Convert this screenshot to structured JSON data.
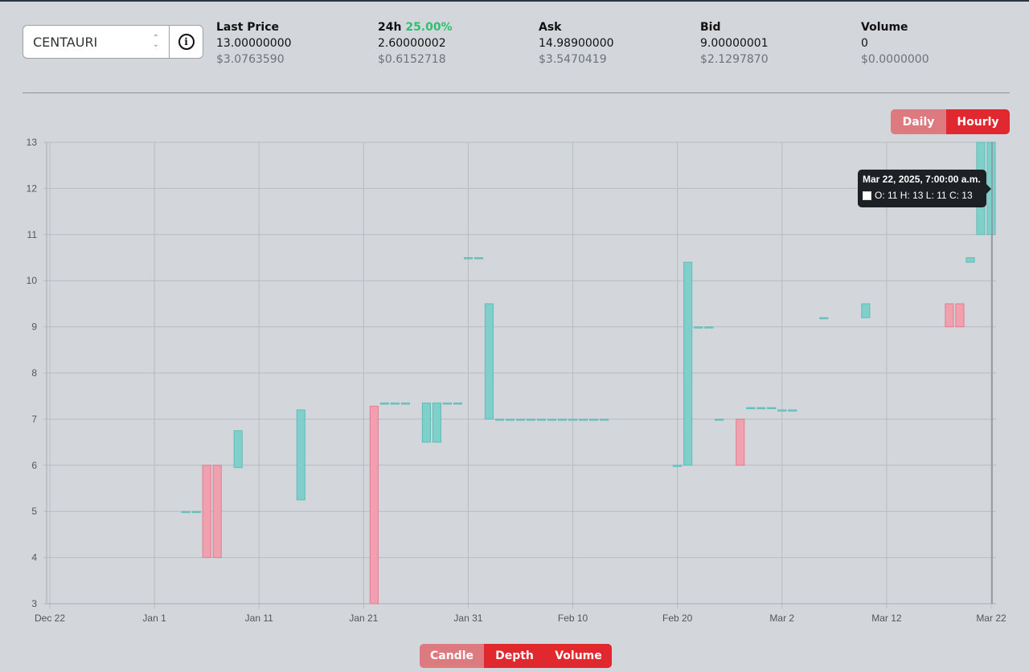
{
  "market": {
    "selected": "CENTAURI"
  },
  "stats": {
    "last_price": {
      "label": "Last Price",
      "value": "13.00000000",
      "usd": "$3.0763590"
    },
    "change_24h": {
      "label": "24h",
      "pct": "25.00%",
      "value": "2.60000002",
      "usd": "$0.6152718"
    },
    "ask": {
      "label": "Ask",
      "value": "14.98900000",
      "usd": "$3.5470419"
    },
    "bid": {
      "label": "Bid",
      "value": "9.00000001",
      "usd": "$2.1297870"
    },
    "volume": {
      "label": "Volume",
      "value": "0",
      "usd": "$0.0000000"
    }
  },
  "interval_buttons": {
    "daily": "Daily",
    "hourly": "Hourly",
    "active": "Hourly"
  },
  "view_buttons": {
    "candle": "Candle",
    "depth": "Depth",
    "volume": "Volume",
    "active": "Candle"
  },
  "tooltip": {
    "title": "Mar 22, 2025, 7:00:00 a.m.",
    "ohlc": "O: 11  H: 13  L: 11  C: 13"
  },
  "colors": {
    "up": "#7fcfcb",
    "down": "#f0a0ae",
    "accent": "#e0282e"
  },
  "chart_data": {
    "type": "candlestick",
    "x_axis": "date",
    "xlim": [
      "2024-12-22",
      "2025-03-22"
    ],
    "x_tick_labels": [
      "Dec 22",
      "Jan 1",
      "Jan 11",
      "Jan 21",
      "Jan 31",
      "Feb 10",
      "Feb 20",
      "Mar 2",
      "Mar 12",
      "Mar 22"
    ],
    "ylim": [
      3,
      13
    ],
    "y_ticks": [
      3,
      4,
      5,
      6,
      7,
      8,
      9,
      10,
      11,
      12,
      13
    ],
    "grid": true,
    "candles": [
      {
        "date": "2025-01-04",
        "o": 5,
        "h": 5,
        "l": 5,
        "c": 5
      },
      {
        "date": "2025-01-05",
        "o": 5,
        "h": 5,
        "l": 5,
        "c": 5
      },
      {
        "date": "2025-01-06",
        "o": 6,
        "h": 6,
        "l": 4,
        "c": 4
      },
      {
        "date": "2025-01-07",
        "o": 6,
        "h": 6,
        "l": 4,
        "c": 4
      },
      {
        "date": "2025-01-09",
        "o": 5.95,
        "h": 6.75,
        "l": 5.95,
        "c": 6.75
      },
      {
        "date": "2025-01-15",
        "o": 5.25,
        "h": 7.2,
        "l": 5.25,
        "c": 7.2
      },
      {
        "date": "2025-01-22",
        "o": 7.28,
        "h": 7.28,
        "l": 3,
        "c": 3
      },
      {
        "date": "2025-01-23",
        "o": 7.35,
        "h": 7.35,
        "l": 7.35,
        "c": 7.35
      },
      {
        "date": "2025-01-24",
        "o": 7.35,
        "h": 7.35,
        "l": 7.35,
        "c": 7.35
      },
      {
        "date": "2025-01-25",
        "o": 7.35,
        "h": 7.35,
        "l": 7.35,
        "c": 7.35
      },
      {
        "date": "2025-01-27",
        "o": 6.5,
        "h": 7.35,
        "l": 6.5,
        "c": 7.35
      },
      {
        "date": "2025-01-28",
        "o": 6.5,
        "h": 7.35,
        "l": 6.5,
        "c": 7.35
      },
      {
        "date": "2025-01-29",
        "o": 7.35,
        "h": 7.35,
        "l": 7.35,
        "c": 7.35
      },
      {
        "date": "2025-01-30",
        "o": 7.35,
        "h": 7.35,
        "l": 7.35,
        "c": 7.35
      },
      {
        "date": "2025-01-31",
        "o": 10.5,
        "h": 10.5,
        "l": 10.5,
        "c": 10.5
      },
      {
        "date": "2025-02-01",
        "o": 10.5,
        "h": 10.5,
        "l": 10.5,
        "c": 10.5
      },
      {
        "date": "2025-02-02",
        "o": 7,
        "h": 9.5,
        "l": 7,
        "c": 9.5
      },
      {
        "date": "2025-02-03",
        "o": 7,
        "h": 7,
        "l": 7,
        "c": 7
      },
      {
        "date": "2025-02-04",
        "o": 7,
        "h": 7,
        "l": 7,
        "c": 7
      },
      {
        "date": "2025-02-05",
        "o": 7,
        "h": 7,
        "l": 7,
        "c": 7
      },
      {
        "date": "2025-02-06",
        "o": 7,
        "h": 7,
        "l": 7,
        "c": 7
      },
      {
        "date": "2025-02-07",
        "o": 7,
        "h": 7,
        "l": 7,
        "c": 7
      },
      {
        "date": "2025-02-08",
        "o": 7,
        "h": 7,
        "l": 7,
        "c": 7
      },
      {
        "date": "2025-02-09",
        "o": 7,
        "h": 7,
        "l": 7,
        "c": 7
      },
      {
        "date": "2025-02-10",
        "o": 7,
        "h": 7,
        "l": 7,
        "c": 7
      },
      {
        "date": "2025-02-11",
        "o": 7,
        "h": 7,
        "l": 7,
        "c": 7
      },
      {
        "date": "2025-02-12",
        "o": 7,
        "h": 7,
        "l": 7,
        "c": 7
      },
      {
        "date": "2025-02-13",
        "o": 7,
        "h": 7,
        "l": 7,
        "c": 7
      },
      {
        "date": "2025-02-20",
        "o": 6,
        "h": 6,
        "l": 6,
        "c": 6
      },
      {
        "date": "2025-02-21",
        "o": 6,
        "h": 10.4,
        "l": 6,
        "c": 10.4
      },
      {
        "date": "2025-02-22",
        "o": 9,
        "h": 9,
        "l": 9,
        "c": 9
      },
      {
        "date": "2025-02-23",
        "o": 9,
        "h": 9,
        "l": 9,
        "c": 9
      },
      {
        "date": "2025-02-24",
        "o": 7,
        "h": 7,
        "l": 7,
        "c": 7
      },
      {
        "date": "2025-02-26",
        "o": 7,
        "h": 7,
        "l": 6,
        "c": 6
      },
      {
        "date": "2025-02-27",
        "o": 7.25,
        "h": 7.25,
        "l": 7.25,
        "c": 7.25
      },
      {
        "date": "2025-02-28",
        "o": 7.25,
        "h": 7.25,
        "l": 7.25,
        "c": 7.25
      },
      {
        "date": "2025-03-01",
        "o": 7.25,
        "h": 7.25,
        "l": 7.25,
        "c": 7.25
      },
      {
        "date": "2025-03-02",
        "o": 7.2,
        "h": 7.2,
        "l": 7.2,
        "c": 7.2
      },
      {
        "date": "2025-03-03",
        "o": 7.2,
        "h": 7.2,
        "l": 7.2,
        "c": 7.2
      },
      {
        "date": "2025-03-06",
        "o": 9.2,
        "h": 9.2,
        "l": 9.2,
        "c": 9.2
      },
      {
        "date": "2025-03-10",
        "o": 9.2,
        "h": 9.5,
        "l": 9.2,
        "c": 9.5
      },
      {
        "date": "2025-03-18",
        "o": 9.5,
        "h": 9.5,
        "l": 9,
        "c": 9
      },
      {
        "date": "2025-03-19",
        "o": 9.5,
        "h": 9.5,
        "l": 9,
        "c": 9
      },
      {
        "date": "2025-03-20",
        "o": 10.4,
        "h": 10.5,
        "l": 10.4,
        "c": 10.5
      },
      {
        "date": "2025-03-21",
        "o": 11,
        "h": 13,
        "l": 11,
        "c": 13
      },
      {
        "date": "2025-03-22",
        "o": 11,
        "h": 13,
        "l": 11,
        "c": 13
      }
    ]
  }
}
